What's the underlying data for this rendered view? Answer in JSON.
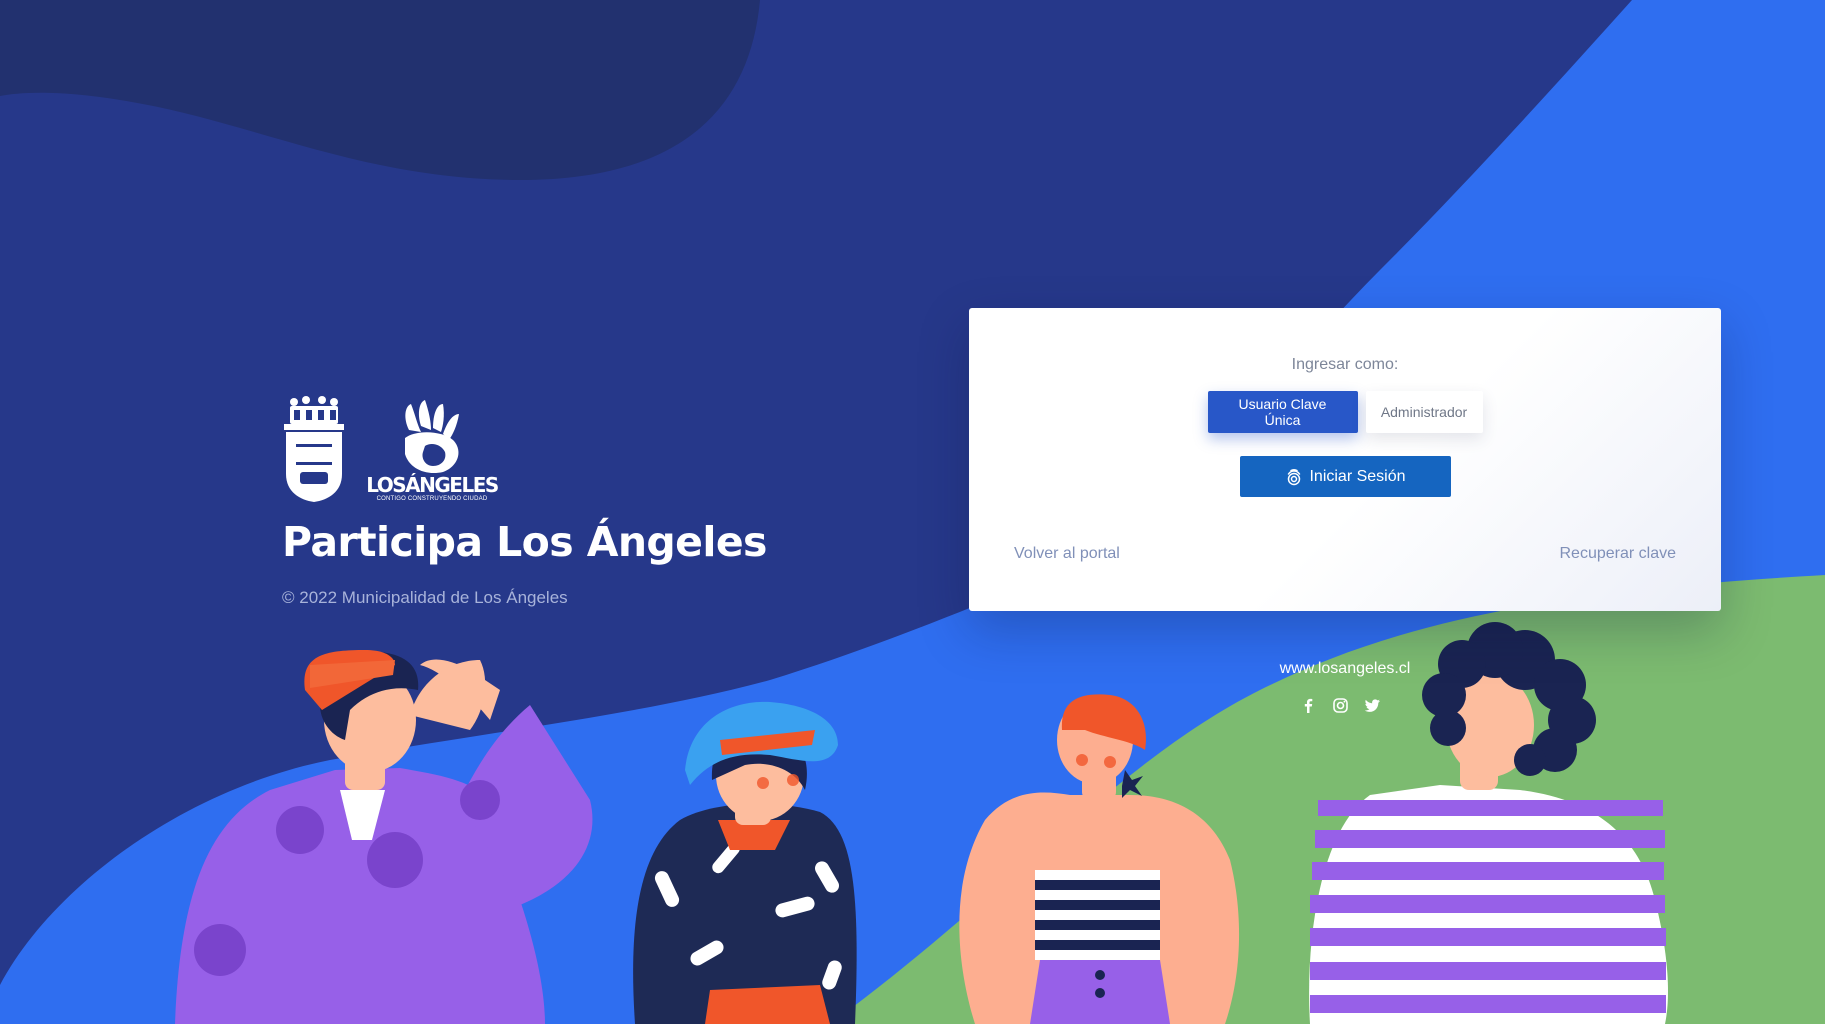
{
  "brand": {
    "title": "Participa Los Ángeles",
    "copyright": "© 2022 Municipalidad de Los Ángeles",
    "logo_text": "LOSÁNGELES",
    "logo_tagline": "CONTIGO CONSTRUYENDO CIUDAD"
  },
  "login": {
    "label": "Ingresar como:",
    "tabs": [
      {
        "label": "Usuario Clave Única",
        "selected": true
      },
      {
        "label": "Administrador",
        "selected": false
      }
    ],
    "submit_label": "Iniciar Sesión",
    "submit_icon": "fingerprint-icon",
    "back_link": "Volver al portal",
    "recover_link": "Recuperar clave"
  },
  "footer": {
    "website": "www.losangeles.cl",
    "social": [
      {
        "icon": "facebook-icon"
      },
      {
        "icon": "instagram-icon"
      },
      {
        "icon": "twitter-icon"
      }
    ]
  },
  "colors": {
    "navy": "#26388a",
    "dark_navy": "#1f3275",
    "bright_blue": "#2f6ef0",
    "green": "#7cbb70",
    "primary_button": "#1565c0",
    "selected_tab": "#2857c8"
  }
}
